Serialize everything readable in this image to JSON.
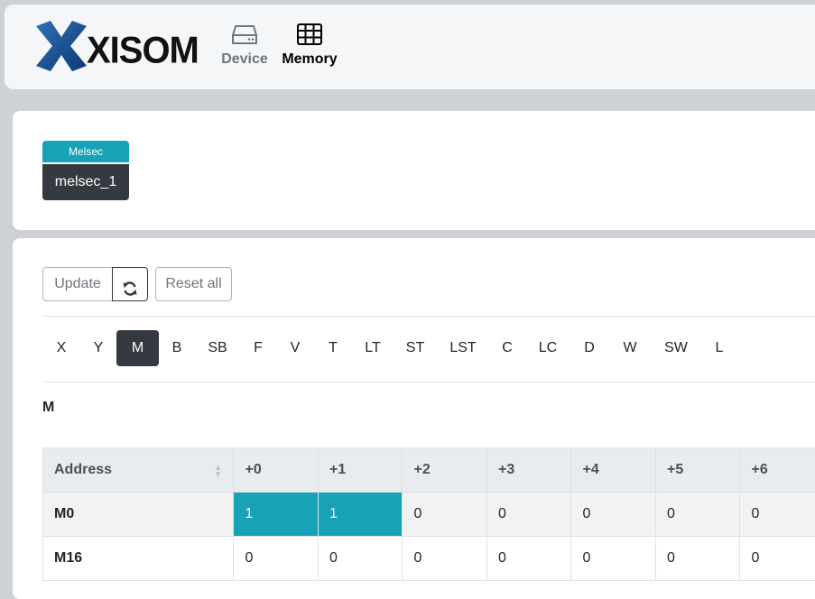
{
  "header": {
    "logo_text": "XISOM",
    "nav": [
      {
        "label": "Device",
        "icon": "drive-icon"
      },
      {
        "label": "Memory",
        "icon": "grid-icon"
      }
    ]
  },
  "plc": {
    "type": "Melsec",
    "name": "melsec_1"
  },
  "toolbar": {
    "update_label": "Update",
    "refresh_icon": "refresh-icon",
    "reset_label": "Reset all"
  },
  "memory_tabs": [
    "X",
    "Y",
    "M",
    "B",
    "SB",
    "F",
    "V",
    "T",
    "LT",
    "ST",
    "LST",
    "C",
    "LC",
    "D",
    "W",
    "SW",
    "L"
  ],
  "active_tab": "M",
  "section_title": "M",
  "table": {
    "headers": [
      "Address",
      "+0",
      "+1",
      "+2",
      "+3",
      "+4",
      "+5",
      "+6"
    ],
    "rows": [
      {
        "address": "M0",
        "values": [
          "1",
          "1",
          "0",
          "0",
          "0",
          "0",
          "0"
        ]
      },
      {
        "address": "M16",
        "values": [
          "0",
          "0",
          "0",
          "0",
          "0",
          "0",
          "0"
        ]
      }
    ]
  },
  "colors": {
    "accent": "#17a2b8",
    "dark": "#343a40"
  }
}
